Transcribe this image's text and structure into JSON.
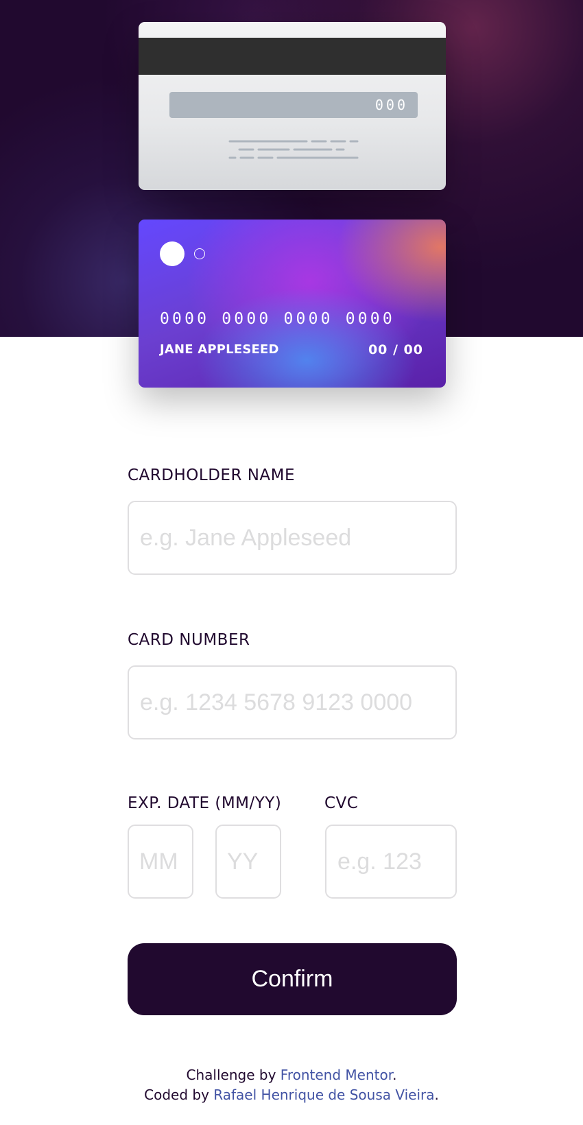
{
  "card_back": {
    "cvc": "000"
  },
  "card_front": {
    "number": "0000 0000 0000 0000",
    "name": "JANE APPLESEED",
    "expiry": "00 / 00"
  },
  "form": {
    "cardholder_label": "CARDHOLDER NAME",
    "cardholder_placeholder": "e.g. Jane Appleseed",
    "cardholder_value": "",
    "number_label": "CARD NUMBER",
    "number_placeholder": "e.g. 1234 5678 9123 0000",
    "number_value": "",
    "exp_label": "EXP. DATE (MM/YY)",
    "mm_placeholder": "MM",
    "yy_placeholder": "YY",
    "cvc_label": "CVC",
    "cvc_placeholder": "e.g. 123",
    "confirm_label": "Confirm"
  },
  "attribution": {
    "line1_prefix": "Challenge by ",
    "line1_link": "Frontend Mentor",
    "line1_suffix": ".",
    "line2_prefix": "Coded by ",
    "line2_link": "Rafael Henrique de Sousa Vieira",
    "line2_suffix": "."
  },
  "colors": {
    "hero_background": "#21092f",
    "button": "#21092f",
    "link": "#4253a4",
    "input_border": "#dfdee0",
    "placeholder": "#dcdcdd"
  }
}
